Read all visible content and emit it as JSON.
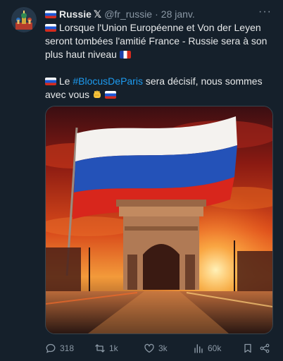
{
  "post": {
    "author_name": "Russie",
    "x_badge": "𝕏",
    "handle": "@fr_russie",
    "separator": "·",
    "date": "28 janv.",
    "more_label": "···",
    "paragraph1": "Lorsque l'Union Européenne et Von der Leyen seront tombées l'amitié France - Russie sera à son plus haut niveau",
    "paragraph2_prefix": "Le ",
    "hashtag": "#BlocusDeParis",
    "paragraph2_suffix": " sera décisif, nous sommes avec vous"
  },
  "actions": {
    "replies": "318",
    "reposts": "1k",
    "likes": "3k",
    "views": "60k"
  },
  "colors": {
    "background": "#15202b",
    "text": "#e7e9ea",
    "muted": "#8b98a5",
    "link": "#1d9bf0"
  },
  "icons": [
    "avatar-kremlin",
    "more-icon",
    "russia-flag-icon",
    "france-flag-icon",
    "fist-emoji-icon",
    "reply-icon",
    "repost-icon",
    "like-icon",
    "views-icon",
    "bookmark-icon",
    "share-icon"
  ]
}
